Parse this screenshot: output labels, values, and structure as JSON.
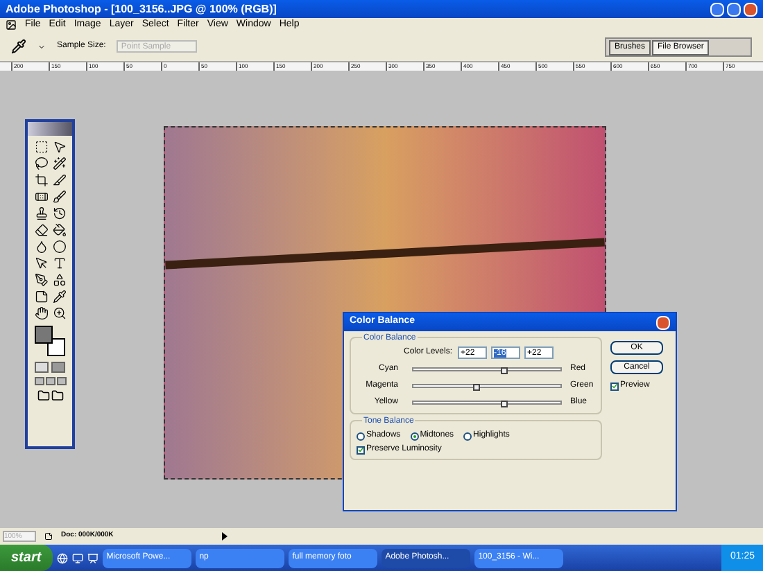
{
  "window": {
    "title": "Adobe Photoshop - [100_3156..JPG @ 100% (RGB)]"
  },
  "menu": [
    "File",
    "Edit",
    "Image",
    "Layer",
    "Select",
    "Filter",
    "View",
    "Window",
    "Help"
  ],
  "options_bar": {
    "sample_size_label": "Sample Size:",
    "sample_size_value": "Point Sample",
    "sample_size_disabled": true
  },
  "palette_well": [
    {
      "label": "Brushes",
      "selected": false
    },
    {
      "label": "File Browser",
      "selected": true
    }
  ],
  "ruler": [
    "200",
    "150",
    "100",
    "50",
    "0",
    "50",
    "100",
    "150",
    "200",
    "250",
    "300",
    "350",
    "400",
    "450",
    "500",
    "550",
    "600",
    "650",
    "700",
    "750"
  ],
  "dialog": {
    "title": "Color Balance",
    "group_title": "Color Balance",
    "levels_label": "Color Levels:",
    "levels": [
      {
        "value": "+22",
        "selected": false
      },
      {
        "value": "-16",
        "selected": true
      },
      {
        "value": "+22",
        "selected": false
      }
    ],
    "sliders": [
      {
        "left": "Cyan",
        "right": "Red",
        "level": 0.61
      },
      {
        "left": "Magenta",
        "right": "Green",
        "level": 0.42
      },
      {
        "left": "Yellow",
        "right": "Blue",
        "level": 0.61
      }
    ],
    "tone_title": "Tone Balance",
    "tones": [
      {
        "label": "Shadows",
        "selected": false
      },
      {
        "label": "Midtones",
        "selected": true
      },
      {
        "label": "Highlights",
        "selected": false
      }
    ],
    "preserve": {
      "label": "Preserve Luminosity",
      "checked": true
    },
    "ok": "OK",
    "cancel": "Cancel",
    "preview": {
      "label": "Preview",
      "checked": true
    }
  },
  "status_bar": {
    "zoom": "100%",
    "doc": "Doc: 000K/000K"
  },
  "taskbar": {
    "start": "start",
    "tasks": [
      {
        "label": "Microsoft Powe...",
        "selected": false
      },
      {
        "label": "np",
        "selected": false
      },
      {
        "label": "full memory foto",
        "selected": false
      },
      {
        "label": "Adobe Photosh...",
        "selected": true
      },
      {
        "label": "100_3156 - Wi...",
        "selected": false
      }
    ],
    "clock": "01:25"
  }
}
